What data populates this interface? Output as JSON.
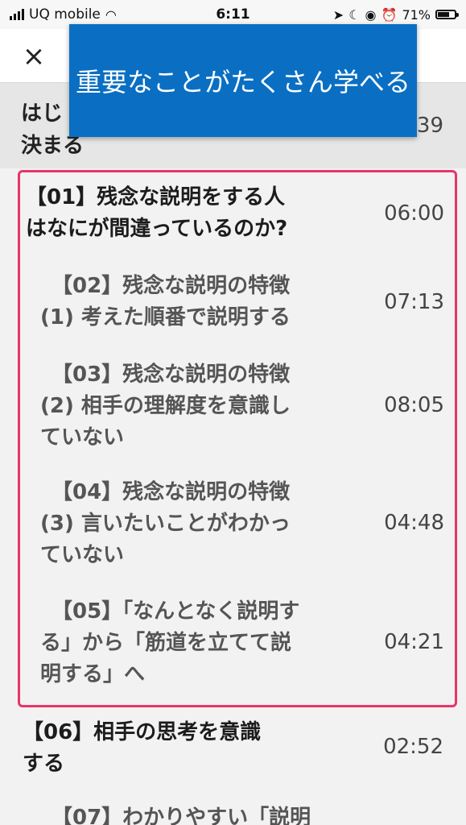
{
  "status": {
    "carrier": "UQ mobile",
    "time": "6:11",
    "battery": "71%",
    "battery_level": 0.71
  },
  "header": {
    "close_label": "×"
  },
  "banner": {
    "text": "重要なことがたくさん学べる"
  },
  "prev_lesson": {
    "title_line1": "はじ",
    "title_line2": "決まる",
    "time": "39"
  },
  "lessons": [
    {
      "id": "01",
      "lines": [
        "【01】残念な説明をする人",
        "はなにが間違っているのか?"
      ],
      "duration": "06:00",
      "level": "main"
    },
    {
      "id": "02",
      "lines": [
        "【02】残念な説明の特徴",
        "(1) 考えた順番で説明する"
      ],
      "duration": "07:13",
      "level": "sub"
    },
    {
      "id": "03",
      "lines": [
        "【03】残念な説明の特徴",
        "(2) 相手の理解度を意識し",
        "ていない"
      ],
      "duration": "08:05",
      "level": "sub"
    },
    {
      "id": "04",
      "lines": [
        "【04】残念な説明の特徴",
        "(3) 言いたいことがわかっ",
        "ていない"
      ],
      "duration": "04:48",
      "level": "sub"
    },
    {
      "id": "05",
      "lines": [
        "【05】「なんとなく説明す",
        "る」から「筋道を立てて説",
        "明する」へ"
      ],
      "duration": "04:21",
      "level": "sub"
    },
    {
      "id": "06",
      "lines": [
        "【06】相手の思考を意識",
        "する"
      ],
      "duration": "02:52",
      "level": "main"
    },
    {
      "id": "07",
      "lines": [
        "【07】わかりやすい「説明"
      ],
      "duration": "",
      "level": "sub"
    }
  ],
  "colors": {
    "banner": "#0a6fc3",
    "highlight_border": "#e8356b"
  }
}
